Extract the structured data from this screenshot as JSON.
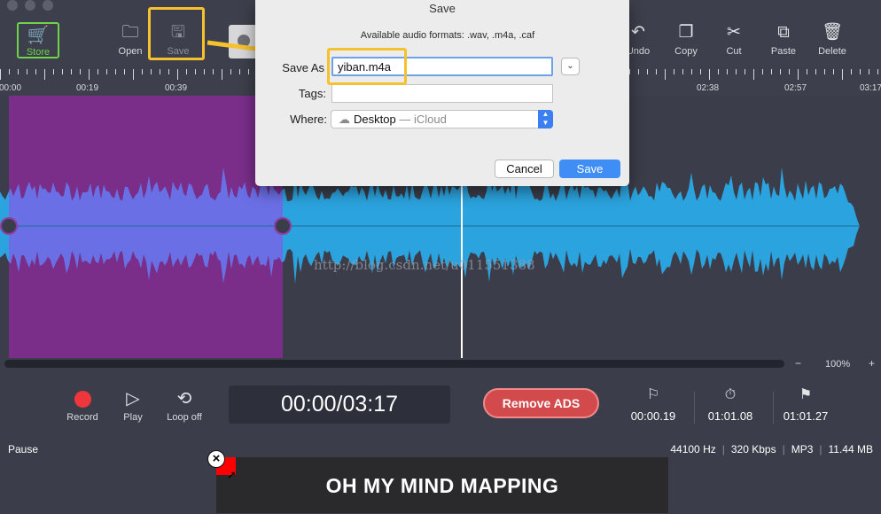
{
  "toolbar": {
    "store_label": "Store",
    "open_label": "Open",
    "save_label": "Save",
    "undo_label": "Undo",
    "copy_label": "Copy",
    "cut_label": "Cut",
    "paste_label": "Paste",
    "delete_label": "Delete",
    "icons": {
      "store": "cart-icon",
      "open": "folder-icon",
      "save": "disk-icon",
      "undo": "undo-icon",
      "copy": "copy-icon",
      "cut": "scissors-icon",
      "paste": "paste-icon",
      "delete": "trash-icon"
    }
  },
  "ruler": {
    "labels": [
      "00:00",
      "00:19",
      "00:39",
      "02:38",
      "02:57",
      "03:17"
    ]
  },
  "waveform": {
    "watermark": "http://blog.csdn.net/u011551388",
    "wave_color": "#2ba3de",
    "selected_wave_color": "#6b6fe6",
    "selection_color": "#7a2e8a"
  },
  "zoom": {
    "minus": "−",
    "level": "100%",
    "plus": "+"
  },
  "transport": {
    "record_label": "Record",
    "play_label": "Play",
    "loop_label": "Loop off",
    "time": "00:00/03:17",
    "remove_ads_label": "Remove ADS",
    "markers": [
      "00:00.19",
      "01:01.08",
      "01:01.27"
    ]
  },
  "status": {
    "state": "Pause",
    "sample_rate": "44100 Hz",
    "bitrate": "320 Kbps",
    "format": "MP3",
    "size": "11.44 MB"
  },
  "ad": {
    "text": "OH MY MIND MAPPING"
  },
  "dialog": {
    "title": "Save",
    "formats": "Available audio formats: .wav, .m4a, .caf",
    "save_as_label": "Save As",
    "save_as_value": "yiban.m4a",
    "tags_label": "Tags:",
    "where_label": "Where:",
    "where_location": "Desktop",
    "where_service": "— iCloud",
    "cancel_label": "Cancel",
    "save_label": "Save"
  },
  "colors": {
    "accent_blue": "#3e8ef6",
    "highlight_yellow": "#f5c12e",
    "store_green": "#6cd34a",
    "remove_ads_red": "#d34a4c"
  }
}
